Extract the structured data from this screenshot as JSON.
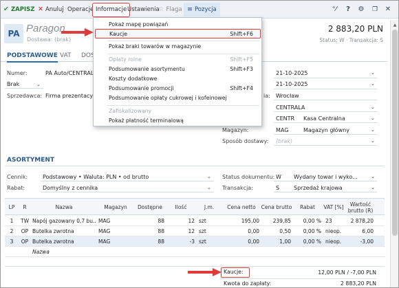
{
  "toolbar": {
    "save": "ZAPISZ",
    "cancel": "Anuluj",
    "operations": "Operacje",
    "info": "Informacje",
    "settings": "Ustawienia",
    "flag": "Flaga",
    "position": "Pozycja",
    "icons": [
      "wand-icon",
      "help-icon",
      "gear-icon",
      "restore-window-icon",
      "close-icon"
    ]
  },
  "header": {
    "badge": "PA",
    "title": "Paragon",
    "subtitle": "Dostawa: (brak)",
    "amount": "2 883,20 PLN",
    "status_line": "Status: W  ·  Transakcja: S"
  },
  "tabs": [
    "PODSTAWOWE",
    "VAT",
    "DOS"
  ],
  "form": {
    "numer_label": "Numer:",
    "numer_value": "PA Auto/CENTRALA/",
    "brak_value": "Brak",
    "sprzedawca_label": "Sprzedawca:",
    "sprzedawca_value": "Firma prezentacyjna",
    "date1": "21-10-2025",
    "date2": "21-10-2025",
    "miejscowosc_label_tail": "ia:",
    "miejscowosc_value": "Wrocław",
    "oddzial_value": "CENTRALA",
    "stanowisko_code": "CENTR",
    "stanowisko_value": "Kasa Centralna",
    "magazyn_label": "Magazyn:",
    "magazyn_code": "MAG",
    "magazyn_value": "Magazyn główny",
    "sposob_label": "Sposób dostawy:",
    "sposob_value": "(brak)"
  },
  "assortment": {
    "title": "ASORTYMENT",
    "cennik_label": "Cennik:",
    "cennik_value": "Podstawowy • Waluta: PLN • od brutto",
    "rabat_label": "Rabat:",
    "rabat_value": "Domyślny z cennika",
    "status_label": "Status dokumentu:",
    "status_code": "W",
    "status_value": "Wydany towar i wyko...",
    "transakcja_label": "Transakcja:",
    "transakcja_code": "S",
    "transakcja_value": "Sprzedaż krajowa"
  },
  "table": {
    "columns": [
      "LP",
      "R",
      "Nazwa",
      "Magazyn",
      "Dostępne",
      "Ilość",
      "J.m.",
      "Cena netto",
      "Cena brutto",
      "Rabat",
      "VAT [%]",
      "Wartość brutto (R)"
    ],
    "rows": [
      [
        "1",
        "TW",
        "Napój gazowany 0,7 bu...",
        "MAG",
        "88",
        "12",
        "szt",
        "195,00",
        "239,85",
        "0,00 %",
        "23",
        "2 878,20"
      ],
      [
        "2",
        "OP",
        "Butelka zwrotna",
        "MAG",
        "88",
        "12",
        "szt",
        "0,00",
        "0,50",
        "0,00 %",
        "nieop.",
        "6,00"
      ],
      [
        "3",
        "OP",
        "Butelka zwrotna",
        "MAG",
        "88",
        "-3",
        "szt",
        "0,00",
        "1,00",
        "0,00 %",
        "nieop.",
        "-3,00"
      ]
    ],
    "new_row_placeholder": "Nazwa"
  },
  "footer": {
    "kaucje_label": "Kaucje:",
    "kaucje_value": "12,00 PLN / -7,00 PLN",
    "kwota_label": "Kwota do zapłaty:",
    "kwota_value": "2 883,20 PLN"
  },
  "menu": {
    "items": [
      {
        "label": "Pokaż mapę powiązań",
        "shortcut": "",
        "disabled": false
      },
      {
        "label": "Kaucje",
        "shortcut": "Shift+F6",
        "disabled": false
      },
      {
        "label": "Pokaż braki towarów w magazynie",
        "shortcut": "",
        "disabled": false
      },
      {
        "label": "Opłaty rolne",
        "shortcut": "Shift+F5",
        "disabled": true
      },
      {
        "label": "Podsumowanie asortymentu",
        "shortcut": "Shift+F3",
        "disabled": false
      },
      {
        "label": "Koszty dodatkowe",
        "shortcut": "",
        "disabled": false
      },
      {
        "label": "Podsumowanie promocji",
        "shortcut": "Shift+F4",
        "disabled": false
      },
      {
        "label": "Podsumowanie opłaty cukrowej i kofeinowej",
        "shortcut": "",
        "disabled": false
      },
      {
        "label": "Zafiskalizowany",
        "shortcut": "",
        "disabled": true
      },
      {
        "label": "Pokaż płatność terminalową",
        "shortcut": "",
        "disabled": false
      }
    ]
  },
  "colors": {
    "accent_blue": "#2b5b8f",
    "highlight_red": "#e23a3a",
    "save_green": "#2e9a3c"
  }
}
